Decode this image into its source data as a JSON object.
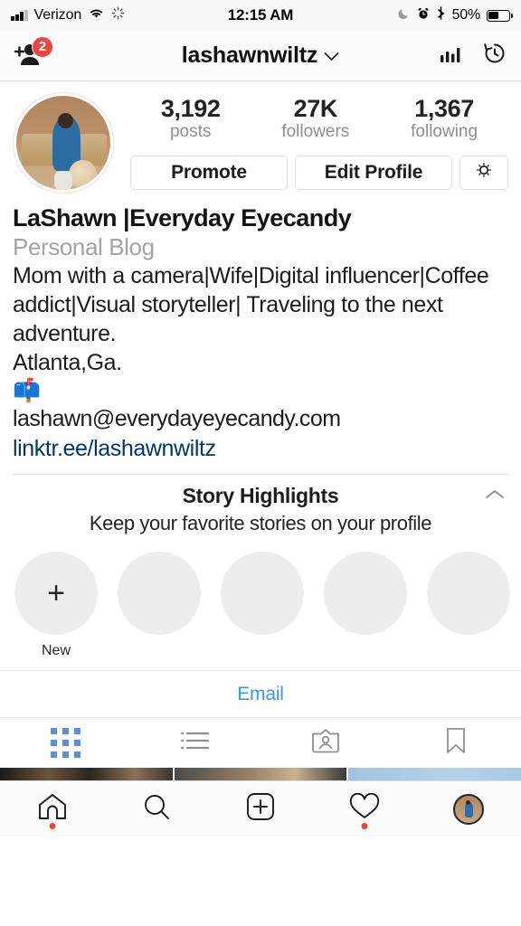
{
  "status_bar": {
    "carrier": "Verizon",
    "time": "12:15 AM",
    "battery_percent": "50%",
    "icons": [
      "signal-bars-icon",
      "wifi-icon",
      "activity-spinner-icon",
      "moon-icon",
      "alarm-clock-icon",
      "bluetooth-icon",
      "battery-icon"
    ]
  },
  "nav": {
    "username": "lashawnwiltz",
    "chevron": "⌄",
    "discover_people_badge": "2",
    "icons": [
      "add-person-icon",
      "insights-bar-chart-icon",
      "archive-history-icon"
    ]
  },
  "profile": {
    "stats": [
      {
        "value": "3,192",
        "label": "posts"
      },
      {
        "value": "27K",
        "label": "followers"
      },
      {
        "value": "1,367",
        "label": "following"
      }
    ],
    "buttons": {
      "promote": "Promote",
      "edit_profile": "Edit Profile",
      "settings_icon": "gear-icon"
    },
    "display_name": "LaShawn |Everyday Eyecandy",
    "category": "Personal Blog",
    "bio": "Mom with a camera|Wife|Digital influencer|Coffee addict|Visual storyteller| Traveling to the next adventure.\nAtlanta,Ga.",
    "bio_emoji": "📫",
    "email": "lashawn@everydayeyecandy.com",
    "website": "linktr.ee/lashawnwiltz",
    "link_color": "#00376b"
  },
  "highlights": {
    "title": "Story Highlights",
    "subtitle": "Keep your favorite stories on your profile",
    "collapse_icon": "chevron-up-icon",
    "items": [
      {
        "label": "New",
        "icon": "plus-icon",
        "placeholder": false
      },
      {
        "label": "",
        "icon": "",
        "placeholder": true
      },
      {
        "label": "",
        "icon": "",
        "placeholder": true
      },
      {
        "label": "",
        "icon": "",
        "placeholder": true
      },
      {
        "label": "",
        "icon": "",
        "placeholder": true
      }
    ]
  },
  "contact": {
    "email_button": "Email",
    "accent_color": "#3897f0"
  },
  "content_tabs": [
    {
      "name": "grid-tab",
      "icon": "grid-icon",
      "active": true
    },
    {
      "name": "list-tab",
      "icon": "list-icon",
      "active": false
    },
    {
      "name": "tagged-tab",
      "icon": "tagged-person-icon",
      "active": false
    },
    {
      "name": "saved-tab",
      "icon": "bookmark-icon",
      "active": false
    }
  ],
  "bottom_bar": [
    {
      "name": "home-tab",
      "icon": "home-icon",
      "dot": true
    },
    {
      "name": "search-tab",
      "icon": "search-icon",
      "dot": false
    },
    {
      "name": "create-tab",
      "icon": "plus-square-icon",
      "dot": false
    },
    {
      "name": "activity-tab",
      "icon": "heart-icon",
      "dot": true
    },
    {
      "name": "profile-tab",
      "icon": "profile-avatar-icon",
      "dot": false
    }
  ]
}
